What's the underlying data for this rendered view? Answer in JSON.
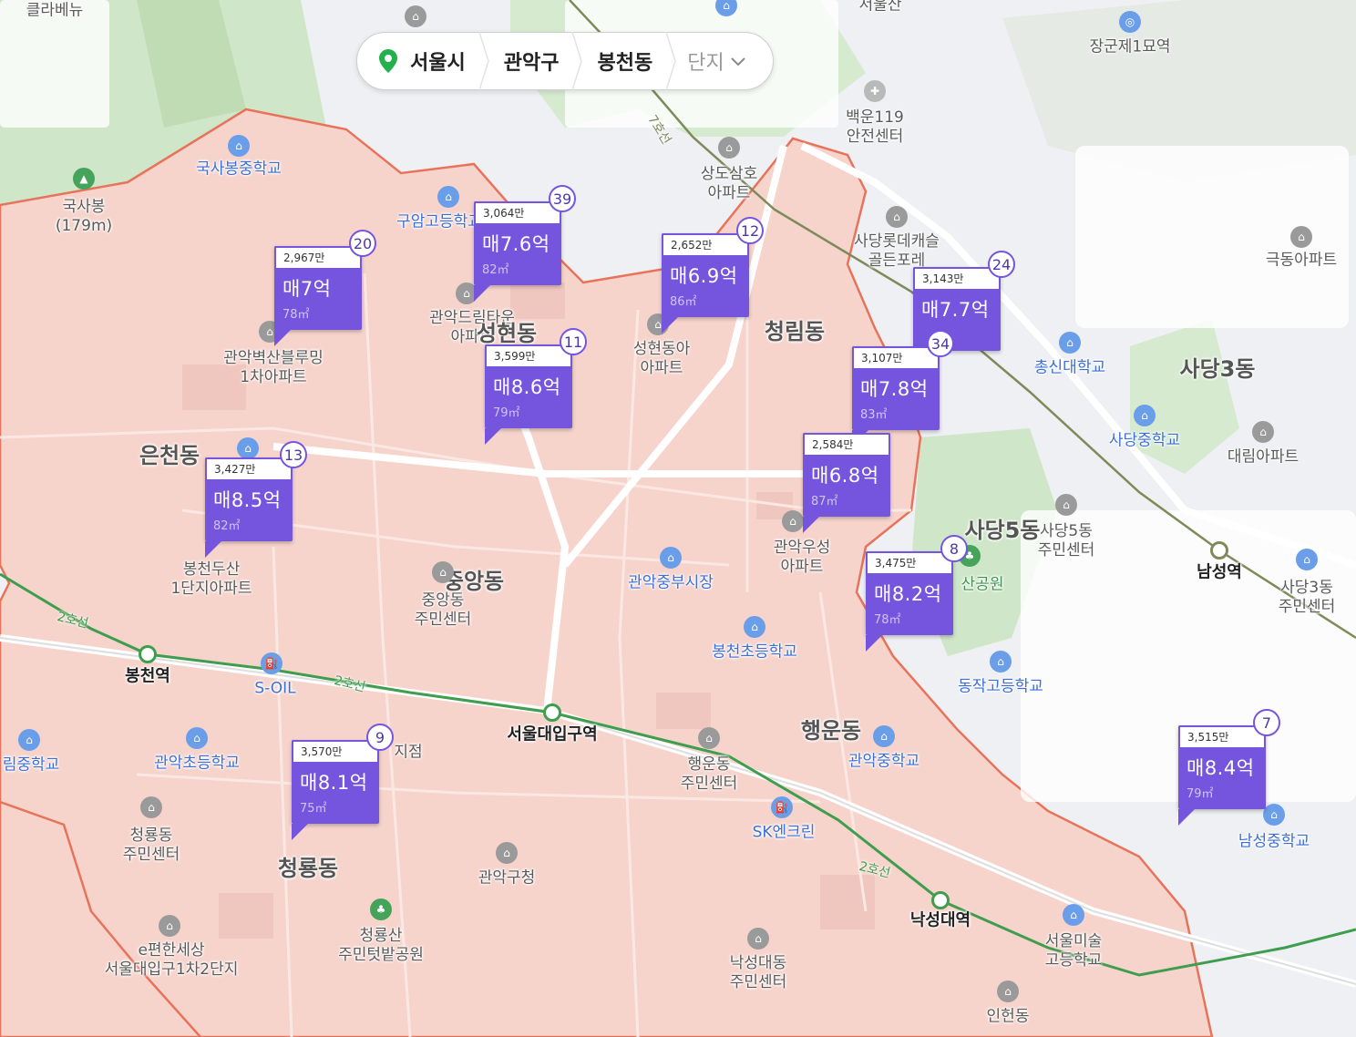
{
  "breadcrumb": {
    "city": "서울시",
    "district": "관악구",
    "dong": "봉천동",
    "complex": "단지"
  },
  "colors": {
    "marker": "#7555dd",
    "district_fill": "#f6d4cc",
    "district_border": "#e7735a",
    "line2": "#3f9d4e",
    "park": "#cfe6c8"
  },
  "markers": [
    {
      "price_per": "2,967만",
      "price": "매7억",
      "area": "78㎡",
      "count": "20"
    },
    {
      "price_per": "3,064만",
      "price": "매7.6억",
      "area": "82㎡",
      "count": "39"
    },
    {
      "price_per": "2,652만",
      "price": "매6.9억",
      "area": "86㎡",
      "count": "12"
    },
    {
      "price_per": "3,143만",
      "price": "매7.7억",
      "area": "",
      "count": "24"
    },
    {
      "price_per": "3,599만",
      "price": "매8.6억",
      "area": "79㎡",
      "count": "11"
    },
    {
      "price_per": "3,107만",
      "price": "매7.8억",
      "area": "83㎡",
      "count": "34"
    },
    {
      "price_per": "3,427만",
      "price": "매8.5억",
      "area": "82㎡",
      "count": "13"
    },
    {
      "price_per": "2,584만",
      "price": "매6.8억",
      "area": "87㎡",
      "count": ""
    },
    {
      "price_per": "3,475만",
      "price": "매8.2억",
      "area": "78㎡",
      "count": "8"
    },
    {
      "price_per": "3,570만",
      "price": "매8.1억",
      "area": "75㎡",
      "count": "9"
    },
    {
      "price_per": "3,515만",
      "price": "매8.4억",
      "area": "79㎡",
      "count": "7"
    }
  ],
  "labels": {
    "klavenue": "클라베뉴",
    "seoul_san": "서울산",
    "janggun": "장군제1묘역",
    "baekun": "백운119\n안전센터",
    "line7": "7호선",
    "gooksabong_school": "국사봉중학교",
    "gooksabong": "국사봉\n(179m)",
    "guam": "구암고등학교",
    "sangdo": "상도삼호\n아파트",
    "sadang_lotte": "사당롯데캐슬\n골든포레",
    "geukdong": "극동아파트",
    "gwanak_byeoksan": "관악벽산블루밍\n1차아파트",
    "gwanak_dream": "관악드림타운\n아파트",
    "seonghyeon_dong": "성현동",
    "seonghyeon_apt": "성현동아\n아파트",
    "cheongrim": "청림동",
    "chongshin": "총신대학교",
    "sadang3": "사당3동",
    "sadang_ms": "사당중학교",
    "daerim": "대림아파트",
    "euncheon": "은천동",
    "sadang5": "사당5동",
    "sadang5_center": "사당5동\n주민센터",
    "namseong": "남성역",
    "sadang3_center": "사당3동\n주민센터",
    "bongcheon_dusan": "봉천두산\n1단지아파트",
    "jungang": "중앙동",
    "jungang_center": "중앙동\n주민센터",
    "jungbu_market": "관악중부시장",
    "woosung": "관악우성\n아파트",
    "park": "산공원",
    "line2": "2호선",
    "bongcheon_stn": "봉천역",
    "soil": "S-OIL",
    "bongcheon_es": "봉천초등학교",
    "dongjak_hs": "동작고등학교",
    "rim_ms": "림중학교",
    "gwanak_es": "관악초등학교",
    "branch": "지점",
    "snu_stn": "서울대입구역",
    "haengun": "행운동",
    "gwanak_ms": "관악중학교",
    "haengun_center": "행운동\n주민센터",
    "namseong_ms": "남성중학교",
    "cheongryong_center": "청룡동\n주민센터",
    "sk": "SK엔크린",
    "cheongryong": "청룡동",
    "gwanak_gu_office": "관악구청",
    "nakseongdae_stn": "낙성대역",
    "seoul_art_hs": "서울미술\n고등학교",
    "pyeonhan": "e편한세상\n서울대입구1차2단지",
    "cheongryongsan": "청룡산\n주민텃밭공원",
    "nakseongdae_center": "낙성대동\n주민센터",
    "inheon": "인헌동"
  }
}
